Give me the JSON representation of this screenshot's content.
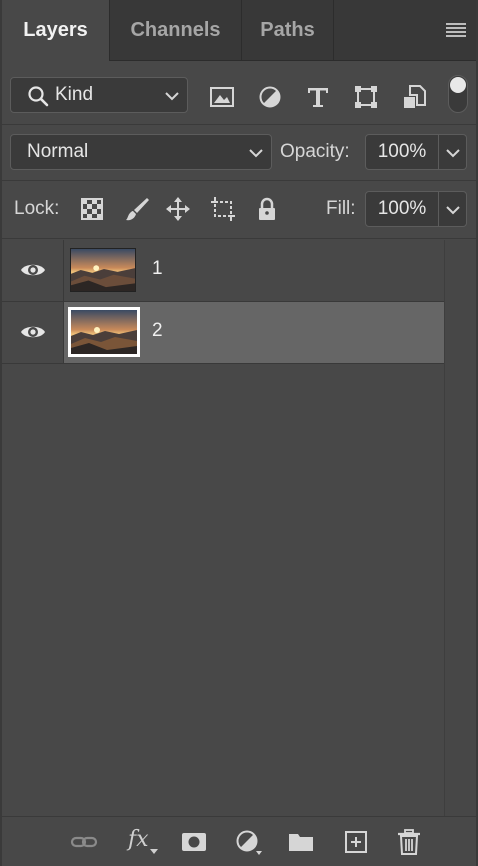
{
  "tabs": [
    {
      "label": "Layers",
      "active": true
    },
    {
      "label": "Channels",
      "active": false
    },
    {
      "label": "Paths",
      "active": false
    }
  ],
  "filter": {
    "kind_label": "Kind",
    "icons": [
      "image-filter-icon",
      "adjustment-filter-icon",
      "type-filter-icon",
      "shape-filter-icon",
      "smart-object-filter-icon"
    ]
  },
  "blend": {
    "mode": "Normal",
    "opacity_label": "Opacity:",
    "opacity_value": "100%"
  },
  "lock": {
    "label": "Lock:",
    "fill_label": "Fill:",
    "fill_value": "100%"
  },
  "layers": [
    {
      "name": "1",
      "visible": true,
      "selected": false
    },
    {
      "name": "2",
      "visible": true,
      "selected": true
    }
  ],
  "bottom_icons": [
    "link-layers-icon",
    "fx-icon",
    "layer-mask-icon",
    "adjustment-layer-icon",
    "group-folder-icon",
    "new-layer-icon",
    "delete-layer-icon"
  ],
  "colors": {
    "panel_bg": "#484848",
    "tabbar_bg": "#383838",
    "selected_row": "#666666",
    "text": "#f0f0f0"
  }
}
